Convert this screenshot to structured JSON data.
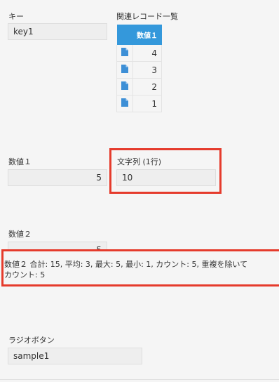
{
  "key_field": {
    "label": "キー",
    "value": "key1"
  },
  "related_records": {
    "title": "関連レコード一覧",
    "column_header": "数値１",
    "rows": [
      {
        "icon": "document-icon",
        "value": "4"
      },
      {
        "icon": "document-icon",
        "value": "3"
      },
      {
        "icon": "document-icon",
        "value": "2"
      },
      {
        "icon": "document-icon",
        "value": "1"
      }
    ]
  },
  "number1_field": {
    "label": "数値１",
    "value": "5"
  },
  "text_field": {
    "label": "文字列 (1行)",
    "value": "10"
  },
  "number2_field": {
    "label": "数値２",
    "value": "5"
  },
  "aggregation": {
    "line1": "数値２ 合計: 15, 平均: 3, 最大: 5, 最小: 1, カウント: 5, 重複を除いて",
    "line2": "カウント: 5"
  },
  "radio_field": {
    "label": "ラジオボタン",
    "value": "sample1"
  },
  "colors": {
    "highlight": "#e53b2c",
    "table_header": "#3498db",
    "icon": "#3d8fd6"
  }
}
